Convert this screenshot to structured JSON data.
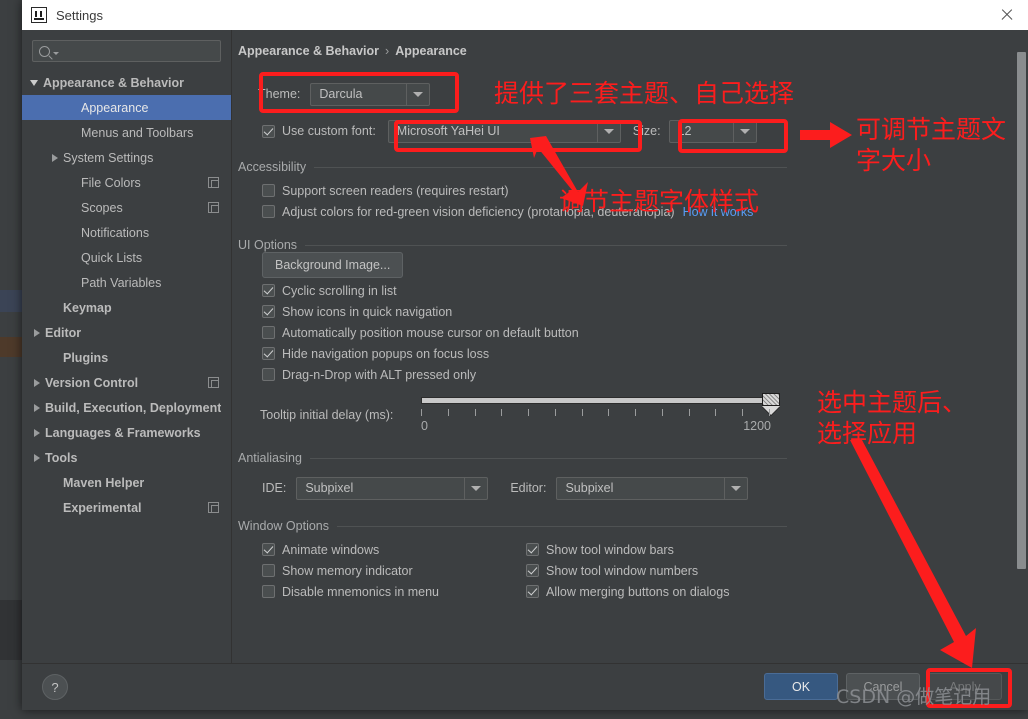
{
  "window": {
    "title": "Settings",
    "app_icon": "intellij-idea-icon",
    "close_icon": "close-icon"
  },
  "sidebar": {
    "search": {
      "placeholder": "",
      "value": "",
      "icon": "search-icon"
    },
    "items": [
      {
        "label": "Appearance & Behavior",
        "arrow": "down",
        "indent": 8,
        "bold": true,
        "selected": false,
        "copy": false
      },
      {
        "label": "Appearance",
        "arrow": "none",
        "indent": 48,
        "bold": false,
        "selected": true,
        "copy": false
      },
      {
        "label": "Menus and Toolbars",
        "arrow": "none",
        "indent": 48,
        "bold": false,
        "selected": false,
        "copy": false
      },
      {
        "label": "System Settings",
        "arrow": "right",
        "indent": 30,
        "bold": false,
        "selected": false,
        "copy": false
      },
      {
        "label": "File Colors",
        "arrow": "none",
        "indent": 48,
        "bold": false,
        "selected": false,
        "copy": true
      },
      {
        "label": "Scopes",
        "arrow": "none",
        "indent": 48,
        "bold": false,
        "selected": false,
        "copy": true
      },
      {
        "label": "Notifications",
        "arrow": "none",
        "indent": 48,
        "bold": false,
        "selected": false,
        "copy": false
      },
      {
        "label": "Quick Lists",
        "arrow": "none",
        "indent": 48,
        "bold": false,
        "selected": false,
        "copy": false
      },
      {
        "label": "Path Variables",
        "arrow": "none",
        "indent": 48,
        "bold": false,
        "selected": false,
        "copy": false
      },
      {
        "label": "Keymap",
        "arrow": "none",
        "indent": 30,
        "bold": true,
        "selected": false,
        "copy": false
      },
      {
        "label": "Editor",
        "arrow": "right",
        "indent": 12,
        "bold": true,
        "selected": false,
        "copy": false
      },
      {
        "label": "Plugins",
        "arrow": "none",
        "indent": 30,
        "bold": true,
        "selected": false,
        "copy": false
      },
      {
        "label": "Version Control",
        "arrow": "right",
        "indent": 12,
        "bold": true,
        "selected": false,
        "copy": true
      },
      {
        "label": "Build, Execution, Deployment",
        "arrow": "right",
        "indent": 12,
        "bold": true,
        "selected": false,
        "copy": false
      },
      {
        "label": "Languages & Frameworks",
        "arrow": "right",
        "indent": 12,
        "bold": true,
        "selected": false,
        "copy": false
      },
      {
        "label": "Tools",
        "arrow": "right",
        "indent": 12,
        "bold": true,
        "selected": false,
        "copy": false
      },
      {
        "label": "Maven Helper",
        "arrow": "none",
        "indent": 30,
        "bold": true,
        "selected": false,
        "copy": false
      },
      {
        "label": "Experimental",
        "arrow": "none",
        "indent": 30,
        "bold": true,
        "selected": false,
        "copy": true
      }
    ]
  },
  "main": {
    "breadcrumb": {
      "root": "Appearance & Behavior",
      "separator": "›",
      "leaf": "Appearance"
    },
    "theme": {
      "label": "Theme:",
      "value": "Darcula"
    },
    "custom_font": {
      "checkbox_label": "Use custom font:",
      "checked": true,
      "value": "Microsoft YaHei UI",
      "size_label": "Size:",
      "size_value": "12"
    },
    "accessibility": {
      "group": "Accessibility",
      "options": [
        {
          "label": "Support screen readers (requires restart)",
          "checked": false
        },
        {
          "label": "Adjust colors for red-green vision deficiency (protanopia, deuteranopia)",
          "checked": false
        }
      ],
      "link": "How it works"
    },
    "ui_options": {
      "group": "UI Options",
      "background_image_button": "Background Image...",
      "options": [
        {
          "label": "Cyclic scrolling in list",
          "checked": true
        },
        {
          "label": "Show icons in quick navigation",
          "checked": true
        },
        {
          "label": "Automatically position mouse cursor on default button",
          "checked": false
        },
        {
          "label": "Hide navigation popups on focus loss",
          "checked": true
        },
        {
          "label": "Drag-n-Drop with ALT pressed only",
          "checked": false
        }
      ],
      "slider": {
        "label": "Tooltip initial delay (ms):",
        "min_label": "0",
        "max_label": "1200",
        "min": 0,
        "max": 1200,
        "value": 1200,
        "tick_count": 14
      }
    },
    "antialiasing": {
      "group": "Antialiasing",
      "ide_label": "IDE:",
      "ide_value": "Subpixel",
      "editor_label": "Editor:",
      "editor_value": "Subpixel"
    },
    "window_options": {
      "group": "Window Options",
      "left": [
        {
          "label": "Animate windows",
          "checked": true
        },
        {
          "label": "Show memory indicator",
          "checked": false
        },
        {
          "label": "Disable mnemonics in menu",
          "checked": false
        }
      ],
      "right": [
        {
          "label": "Show tool window bars",
          "checked": true
        },
        {
          "label": "Show tool window numbers",
          "checked": true
        },
        {
          "label": "Allow merging buttons on dialogs",
          "checked": true
        }
      ]
    }
  },
  "footer": {
    "help_label": "?",
    "ok": "OK",
    "cancel": "Cancel",
    "apply": "Apply"
  },
  "annotations": {
    "theme_note": "提供了三套主题、自己选择",
    "size_note_line1": "可调节主题文",
    "size_note_line2": "字大小",
    "font_note": "调节主题字体样式",
    "apply_note_line1": "选中主题后、",
    "apply_note_line2": "选择应用",
    "color": "#fc1d1d"
  },
  "watermark": "CSDN @做笔记用"
}
